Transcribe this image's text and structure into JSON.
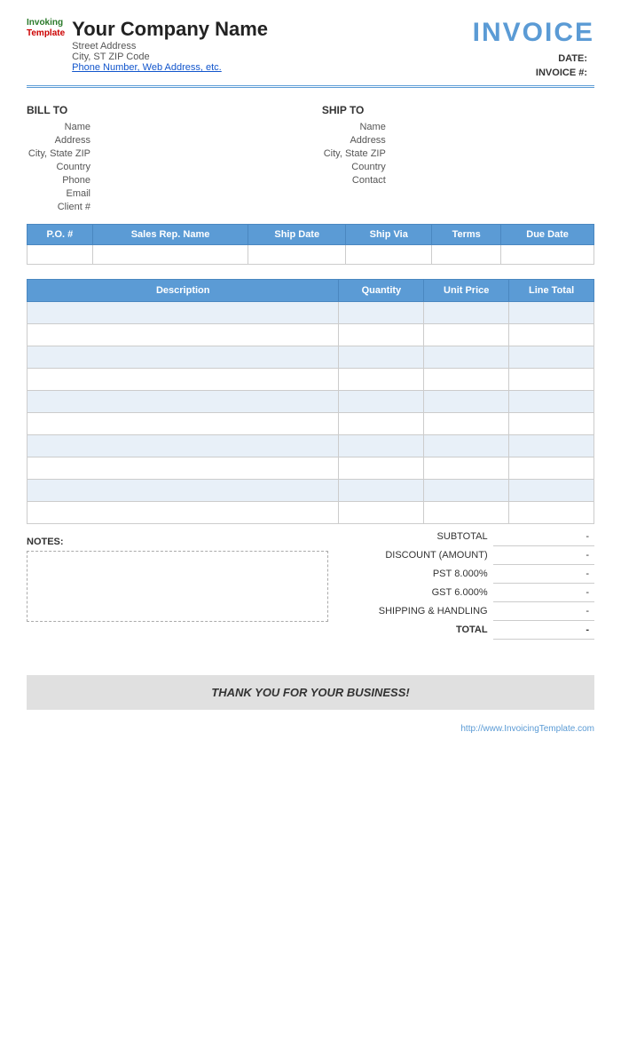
{
  "company": {
    "name": "Your Company Name",
    "street": "Street Address",
    "cityStateZip": "City, ST  ZIP Code",
    "contact": "Phone Number, Web Address, etc."
  },
  "invoice": {
    "title": "INVOICE",
    "dateLabel": "DATE:",
    "dateValue": "",
    "numberLabel": "INVOICE #:",
    "numberValue": ""
  },
  "logo": {
    "invoking": "Invoking",
    "template": "Template"
  },
  "billTo": {
    "header": "BILL TO",
    "fields": [
      {
        "label": "Name",
        "value": "Name"
      },
      {
        "label": "Address",
        "value": "Address"
      },
      {
        "label": "City, State ZIP",
        "value": "City, State ZIP"
      },
      {
        "label": "Country",
        "value": "Country"
      },
      {
        "label": "Phone",
        "value": "Phone"
      },
      {
        "label": "Email",
        "value": "Email"
      },
      {
        "label": "Client #",
        "value": "Client #"
      }
    ]
  },
  "shipTo": {
    "header": "SHIP TO",
    "fields": [
      {
        "label": "Name",
        "value": "Name"
      },
      {
        "label": "Address",
        "value": "Address"
      },
      {
        "label": "City, State ZIP",
        "value": "City, State ZIP"
      },
      {
        "label": "Country",
        "value": "Country"
      },
      {
        "label": "Contact",
        "value": "Contact"
      }
    ]
  },
  "orderHeaders": [
    "P.O. #",
    "Sales Rep. Name",
    "Ship Date",
    "Ship Via",
    "Terms",
    "Due Date"
  ],
  "itemHeaders": [
    "Description",
    "Quantity",
    "Unit Price",
    "Line Total"
  ],
  "items": [
    {
      "desc": "",
      "qty": "",
      "price": "",
      "total": ""
    },
    {
      "desc": "",
      "qty": "",
      "price": "",
      "total": ""
    },
    {
      "desc": "",
      "qty": "",
      "price": "",
      "total": ""
    },
    {
      "desc": "",
      "qty": "",
      "price": "",
      "total": ""
    },
    {
      "desc": "",
      "qty": "",
      "price": "",
      "total": ""
    },
    {
      "desc": "",
      "qty": "",
      "price": "",
      "total": ""
    },
    {
      "desc": "",
      "qty": "",
      "price": "",
      "total": ""
    },
    {
      "desc": "",
      "qty": "",
      "price": "",
      "total": ""
    },
    {
      "desc": "",
      "qty": "",
      "price": "",
      "total": ""
    },
    {
      "desc": "",
      "qty": "",
      "price": "",
      "total": ""
    }
  ],
  "totals": {
    "subtotalLabel": "SUBTOTAL",
    "subtotalValue": "-",
    "discountLabel": "DISCOUNT (AMOUNT)",
    "discountValue": "-",
    "pstLabel": "PST",
    "pstRate": "8.000%",
    "pstValue": "-",
    "gstLabel": "GST",
    "gstRate": "6.000%",
    "gstValue": "-",
    "shippingLabel": "SHIPPING & HANDLING",
    "shippingValue": "-",
    "totalLabel": "TOTAL",
    "totalValue": "-"
  },
  "notes": {
    "label": "NOTES:"
  },
  "thankYou": {
    "text": "THANK YOU FOR YOUR BUSINESS!"
  },
  "footer": {
    "url": "http://www.InvoicingTemplate.com"
  }
}
